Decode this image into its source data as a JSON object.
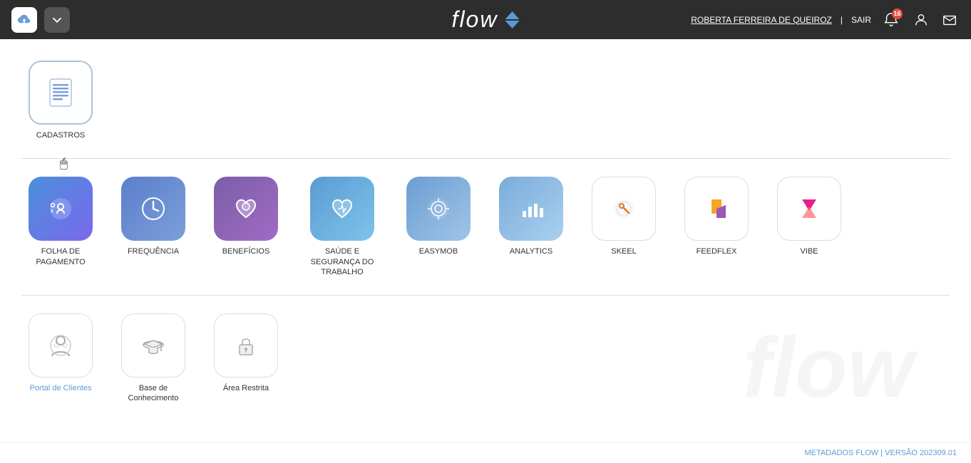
{
  "header": {
    "logo": "flow",
    "user_label": "ROBERTA FERREIRA DE QUEIROZ",
    "separator": "|",
    "logout_label": "SAIR",
    "notif_count": "16"
  },
  "sections": [
    {
      "id": "cadastros",
      "apps": [
        {
          "id": "cadastros",
          "label": "CADASTROS",
          "icon_type": "cadastros"
        }
      ]
    },
    {
      "id": "main-apps",
      "apps": [
        {
          "id": "folha",
          "label": "FOLHA DE PAGAMENTO",
          "icon_type": "folha"
        },
        {
          "id": "frequencia",
          "label": "FREQUÊNCIA",
          "icon_type": "frequencia"
        },
        {
          "id": "beneficios",
          "label": "BENEFÍCIOS",
          "icon_type": "beneficios"
        },
        {
          "id": "saude",
          "label": "SAÚDE E SEGURANÇA DO TRABALHO",
          "icon_type": "saude"
        },
        {
          "id": "easymob",
          "label": "EASYMOB",
          "icon_type": "easymob"
        },
        {
          "id": "analytics",
          "label": "ANALYTICS",
          "icon_type": "analytics"
        },
        {
          "id": "skeel",
          "label": "SKEEL",
          "icon_type": "skeel"
        },
        {
          "id": "feedflex",
          "label": "FEEDFLEX",
          "icon_type": "feedflex"
        },
        {
          "id": "vibe",
          "label": "VIBE",
          "icon_type": "vibe"
        }
      ]
    },
    {
      "id": "links",
      "apps": [
        {
          "id": "portal",
          "label": "Portal de Clientes",
          "icon_type": "portal"
        },
        {
          "id": "base",
          "label": "Base de Conhecimento",
          "icon_type": "base"
        },
        {
          "id": "restrita",
          "label": "Área Restrita",
          "icon_type": "restrita"
        }
      ]
    }
  ],
  "footer": {
    "label": "METADADOS FLOW | VERSÃO 202309.01"
  }
}
